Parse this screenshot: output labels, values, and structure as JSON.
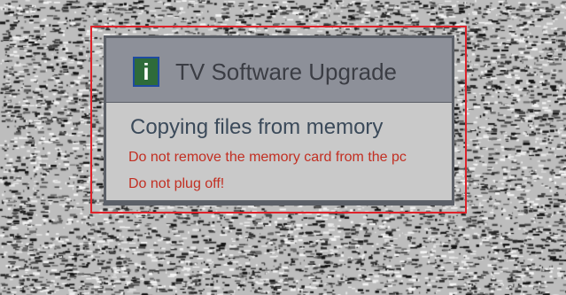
{
  "dialog": {
    "icon": "info-icon",
    "icon_glyph": "i",
    "title": "TV Software Upgrade",
    "status": "Copying files from memory",
    "warnings": [
      "Do not remove the memory card from the pc",
      "Do not plug off!"
    ]
  },
  "colors": {
    "highlight_border": "#e0222a",
    "warning_text": "#c22f22",
    "icon_background": "#2e6b3a",
    "icon_border": "#1d4aa0",
    "header_background": "#8d9099",
    "body_background": "#c9c9c9"
  }
}
